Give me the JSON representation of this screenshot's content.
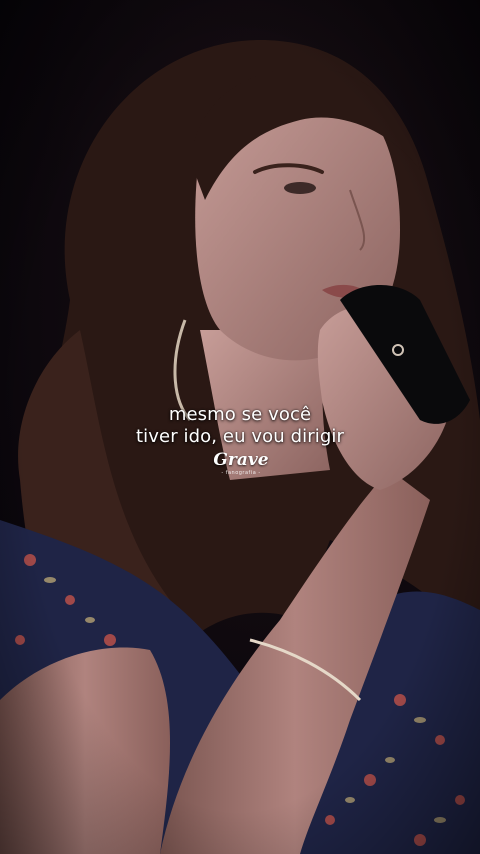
{
  "caption": {
    "line1": "mesmo se você",
    "line2": "tiver ido, eu vou dirigir"
  },
  "watermark": {
    "logo_text": "Grave",
    "tagline": "- fanografia -"
  },
  "colors": {
    "background": "#0d070b",
    "caption_text": "#ffffff",
    "skin": "#b98d88",
    "hair": "#2a1814",
    "dress": "#1f2446"
  }
}
